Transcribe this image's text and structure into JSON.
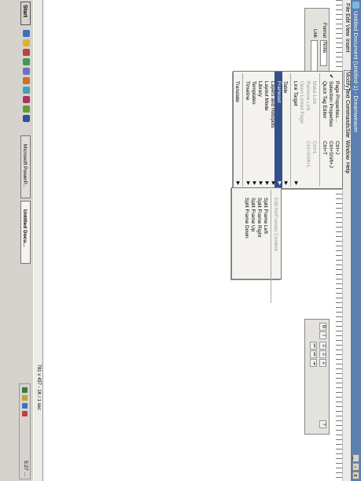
{
  "window": {
    "title": "Untitled Document (Untitled-1) - Dreamweaver",
    "controls": [
      "_",
      "▫",
      "x"
    ]
  },
  "menubar": [
    "File",
    "Edit",
    "View",
    "Insert",
    "Modify",
    "Text",
    "Commands",
    "Site",
    "Window",
    "Help"
  ],
  "properties": {
    "format_label": "Format",
    "format_value": "None",
    "link_label": "Link"
  },
  "modify_menu": {
    "items": [
      {
        "label": "Page Properties...",
        "shortcut": "Ctrl+J",
        "enabled": true
      },
      {
        "label": "Selection Properties",
        "shortcut": "Ctrl+Shift+J",
        "enabled": true,
        "checked": true
      },
      {
        "label": "Quick Tag Editor",
        "shortcut": "Ctrl+T",
        "enabled": true
      },
      {
        "separator": true
      },
      {
        "label": "Make Link",
        "shortcut": "Ctrl+L",
        "enabled": false
      },
      {
        "label": "Remove Link",
        "shortcut": "Ctrl+Shift+L",
        "enabled": false
      },
      {
        "label": "Open Linked Page",
        "enabled": false
      },
      {
        "label": "Link Target",
        "submenu": true,
        "enabled": true
      },
      {
        "separator": true
      },
      {
        "label": "Table",
        "submenu": true,
        "enabled": true
      },
      {
        "label": "Frameset",
        "submenu": true,
        "enabled": true,
        "highlighted": true
      },
      {
        "label": "Layers and Hotspots",
        "submenu": true,
        "enabled": true
      },
      {
        "label": "Layout Mode",
        "submenu": true,
        "enabled": true
      },
      {
        "label": "Library",
        "submenu": true,
        "enabled": true
      },
      {
        "label": "Templates",
        "submenu": true,
        "enabled": true
      },
      {
        "label": "Timeline",
        "submenu": true,
        "enabled": true
      },
      {
        "separator": true
      },
      {
        "label": "Translate",
        "submenu": true,
        "enabled": true
      }
    ]
  },
  "frameset_menu": {
    "items": [
      {
        "label": "Edit NoFrames Content",
        "enabled": false
      },
      {
        "separator": true
      },
      {
        "label": "Split Frame Left",
        "enabled": true
      },
      {
        "label": "Split Frame Right",
        "enabled": true
      },
      {
        "label": "Split Frame Up",
        "enabled": true
      },
      {
        "label": "Split Frame Down",
        "enabled": true
      }
    ]
  },
  "statusbar": {
    "info": "781 x 437 - 1K / 1 sec"
  },
  "taskbar": {
    "start_label": "Start",
    "tasks": [
      {
        "label": "Microsoft PowerP...",
        "active": false
      },
      {
        "label": "Untitled Docu...",
        "active": true
      }
    ],
    "clock": "5:27 ..."
  },
  "colors": {
    "titlebar": "#5b7fb0",
    "menu_highlight": "#33508a",
    "taskbar": "#d6d3ce"
  }
}
